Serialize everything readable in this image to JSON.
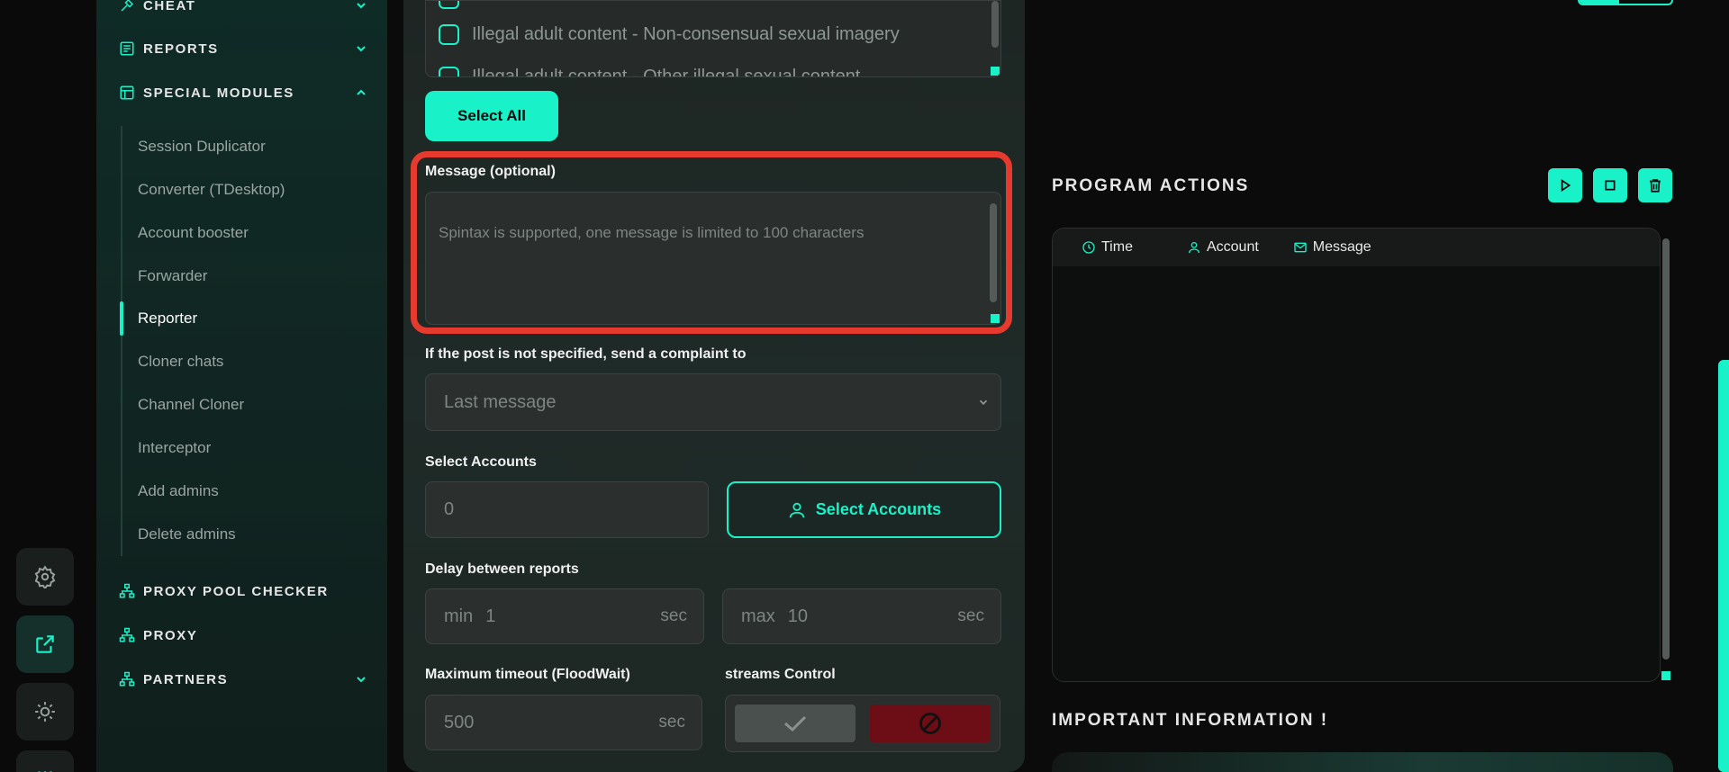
{
  "sidebar": {
    "sections": {
      "cheat": "CHEAT",
      "reports": "REPORTS",
      "special_modules": "SPECIAL MODULES",
      "proxy_pool_checker": "PROXY POOL CHECKER",
      "proxy": "PROXY",
      "partners": "PARTNERS"
    },
    "items": [
      {
        "label": "Session Duplicator"
      },
      {
        "label": "Converter (TDesktop)"
      },
      {
        "label": "Account booster"
      },
      {
        "label": "Forwarder"
      },
      {
        "label": "Reporter"
      },
      {
        "label": "Cloner chats"
      },
      {
        "label": "Channel Cloner"
      },
      {
        "label": "Interceptor"
      },
      {
        "label": "Add admins"
      },
      {
        "label": "Delete admins"
      }
    ],
    "active_item": "Reporter"
  },
  "form": {
    "reasons": [
      "Illegal adult content - Non-consensual sexual imagery",
      "Illegal adult content - Other illegal sexual content"
    ],
    "select_all": "Select All",
    "message_label": "Message (optional)",
    "message_placeholder": "Spintax is supported, one message is limited to 100 characters",
    "fallback_label": "If the post is not specified, send a complaint to",
    "fallback_value": "Last message",
    "accounts_label": "Select Accounts",
    "accounts_count": "0",
    "select_accounts_button": "Select Accounts",
    "delay_label": "Delay between reports",
    "delay_min_prefix": "min",
    "delay_min": "1",
    "delay_max_prefix": "max",
    "delay_max": "10",
    "unit": "sec",
    "timeout_label": "Maximum timeout (FloodWait)",
    "timeout_value": "500",
    "streams_label": "streams Control"
  },
  "program_actions": {
    "title": "PROGRAM ACTIONS",
    "columns": {
      "time": "Time",
      "account": "Account",
      "message": "Message"
    }
  },
  "important_info": {
    "title": "IMPORTANT INFORMATION !"
  },
  "colors": {
    "accent": "#19f2c8",
    "highlight": "#e53a2d",
    "stop": "#6d0d16"
  }
}
